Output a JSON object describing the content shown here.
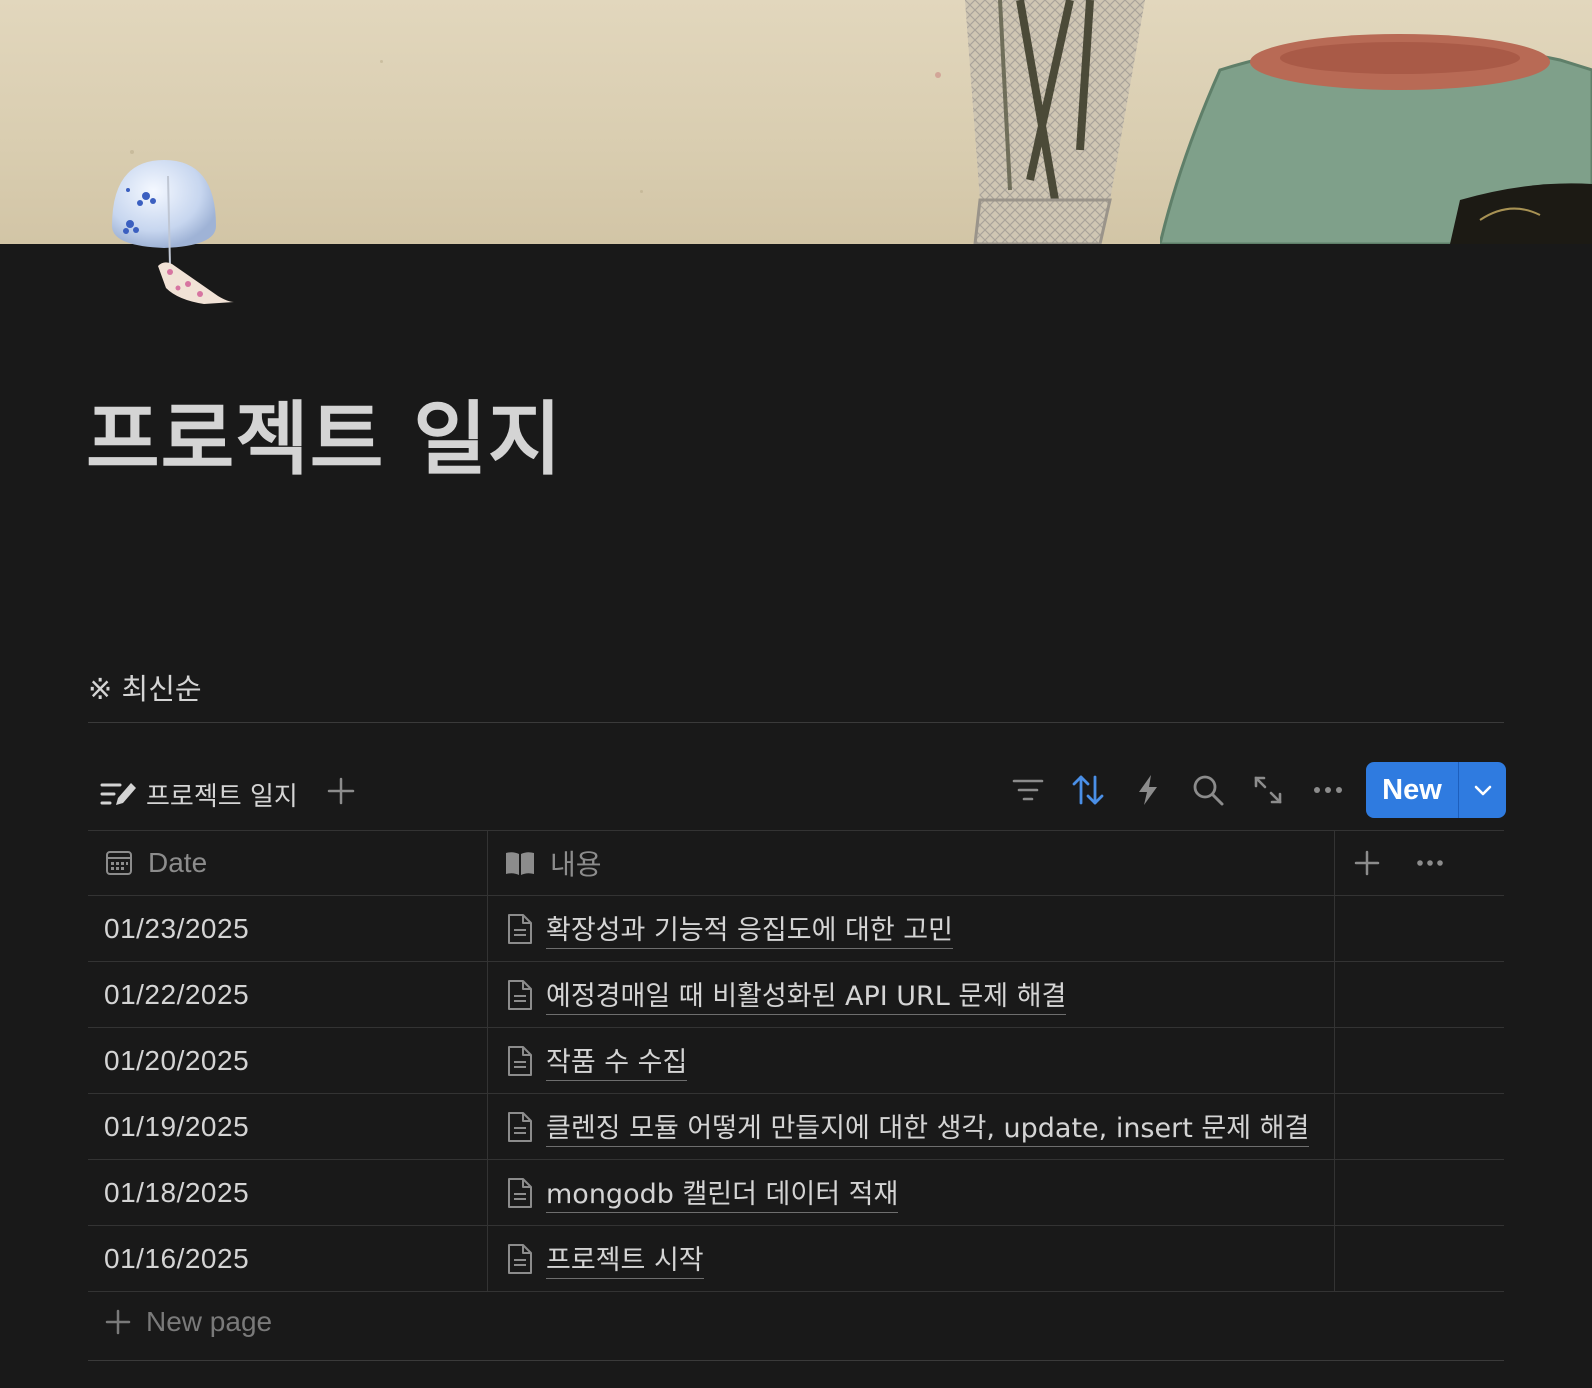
{
  "page": {
    "title": "프로젝트 일지",
    "icon": "wind-chime-icon",
    "note": "※ 최신순"
  },
  "database": {
    "view_name": "프로젝트 일지",
    "new_button_label": "New",
    "columns": [
      {
        "name": "Date",
        "icon": "calendar-icon"
      },
      {
        "name": "내용",
        "icon": "book-icon"
      }
    ],
    "rows": [
      {
        "date": "01/23/2025",
        "title": "확장성과 기능적 응집도에 대한 고민"
      },
      {
        "date": "01/22/2025",
        "title": "예정경매일 때 비활성화된 API URL 문제 해결"
      },
      {
        "date": "01/20/2025",
        "title": "작품 수 수집"
      },
      {
        "date": "01/19/2025",
        "title": "클렌징 모듈 어떻게 만들지에 대한 생각, update, insert 문제 해결"
      },
      {
        "date": "01/18/2025",
        "title": "mongodb 캘린더 데이터 적재"
      },
      {
        "date": "01/16/2025",
        "title": "프로젝트 시작"
      }
    ],
    "new_page_label": "New page"
  },
  "colors": {
    "background": "#191919",
    "accent": "#2f7be0",
    "sort_active": "#4a8fe7",
    "text": "#d4d4d4",
    "muted": "#8c8c8c"
  }
}
